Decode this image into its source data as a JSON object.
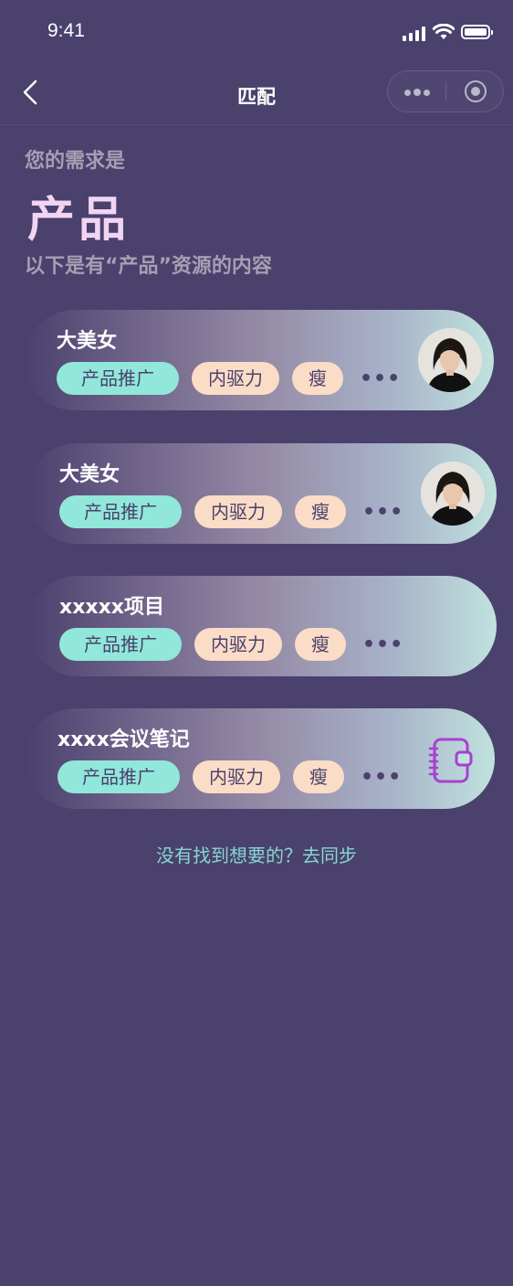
{
  "status_bar": {
    "time": "9:41"
  },
  "nav": {
    "title": "匹配"
  },
  "need": {
    "label": "您的需求是",
    "value": "产品",
    "description": "以下是有“产品”资源的内容"
  },
  "cards": [
    {
      "title": "大美女",
      "tags": [
        "产品推广",
        "内驱力",
        "瘦"
      ],
      "more": "•••",
      "thumb": "avatar"
    },
    {
      "title": "大美女",
      "tags": [
        "产品推广",
        "内驱力",
        "瘦"
      ],
      "more": "•••",
      "thumb": "avatar"
    },
    {
      "title": "xxxxx项目",
      "tags": [
        "产品推广",
        "内驱力",
        "瘦"
      ],
      "more": "•••",
      "thumb": "none"
    },
    {
      "title": "xxxx会议笔记",
      "tags": [
        "产品推广",
        "内驱力",
        "瘦"
      ],
      "more": "•••",
      "thumb": "notebook-icon"
    }
  ],
  "footer": {
    "link": "没有找到想要的？去同步"
  },
  "colors": {
    "background": "#4a416d",
    "tag_primary": "#91e7d9",
    "tag_secondary": "#fbdcc6",
    "accent_title": "#f2d5f2",
    "link": "#87d7cf",
    "notebook_icon": "#a93fd0"
  }
}
